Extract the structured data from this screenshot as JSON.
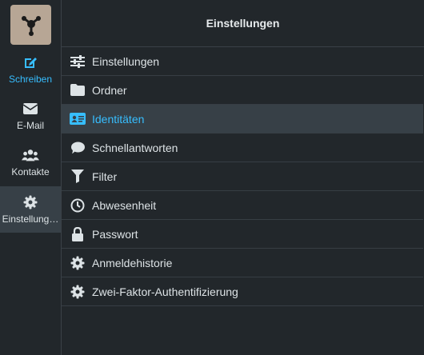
{
  "nav": {
    "items": [
      {
        "label": "Schreiben",
        "icon": "compose-icon"
      },
      {
        "label": "E-Mail",
        "icon": "envelope-icon"
      },
      {
        "label": "Kontakte",
        "icon": "contacts-icon"
      },
      {
        "label": "Einstellung…",
        "icon": "gear-icon"
      }
    ],
    "logo": "app-logo-icon"
  },
  "header": {
    "title": "Einstellungen"
  },
  "settings": {
    "items": [
      {
        "label": "Einstellungen",
        "icon": "sliders-icon"
      },
      {
        "label": "Ordner",
        "icon": "folder-icon"
      },
      {
        "label": "Identitäten",
        "icon": "id-card-icon"
      },
      {
        "label": "Schnellantworten",
        "icon": "speech-bubble-icon"
      },
      {
        "label": "Filter",
        "icon": "funnel-icon"
      },
      {
        "label": "Abwesenheit",
        "icon": "clock-icon"
      },
      {
        "label": "Passwort",
        "icon": "lock-icon"
      },
      {
        "label": "Anmeldehistorie",
        "icon": "gear-icon"
      },
      {
        "label": "Zwei-Faktor-Authentifizierung",
        "icon": "gear-icon"
      }
    ],
    "selected": "Identitäten"
  },
  "colors": {
    "accent": "#37beff",
    "background": "#22272b",
    "selected_bg": "#374047"
  }
}
